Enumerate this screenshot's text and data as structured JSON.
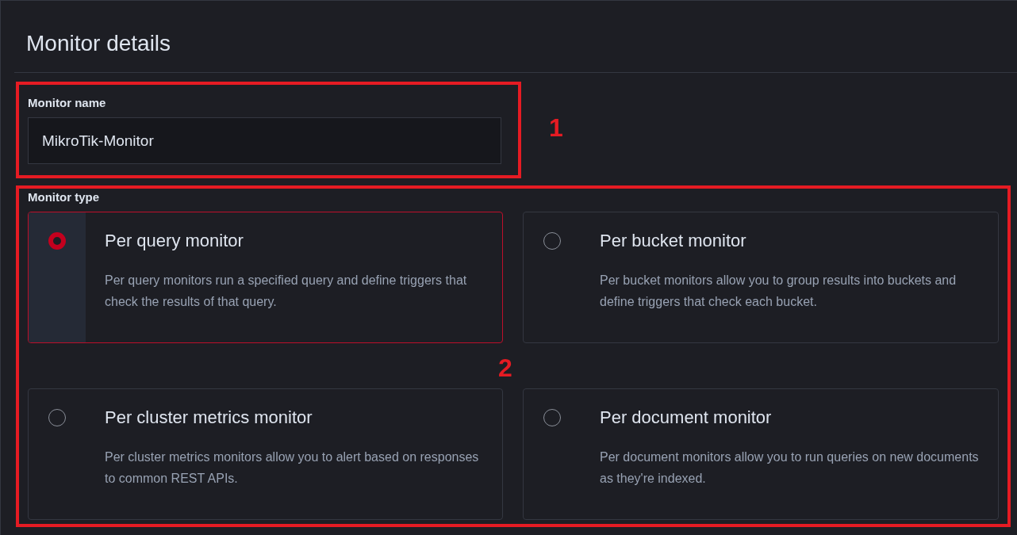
{
  "section": {
    "title": "Monitor details"
  },
  "monitor_name": {
    "label": "Monitor name",
    "value": "MikroTik-Monitor",
    "annotation": "1"
  },
  "monitor_type": {
    "label": "Monitor type",
    "annotation": "2",
    "options": [
      {
        "title": "Per query monitor",
        "description": "Per query monitors run a specified query and define triggers that check the results of that query.",
        "selected": true
      },
      {
        "title": "Per bucket monitor",
        "description": "Per bucket monitors allow you to group results into buckets and define triggers that check each bucket.",
        "selected": false
      },
      {
        "title": "Per cluster metrics monitor",
        "description": "Per cluster metrics monitors allow you to alert based on responses to common REST APIs.",
        "selected": false
      },
      {
        "title": "Per document monitor",
        "description": "Per document monitors allow you to run queries on new documents as they're indexed.",
        "selected": false
      }
    ]
  }
}
